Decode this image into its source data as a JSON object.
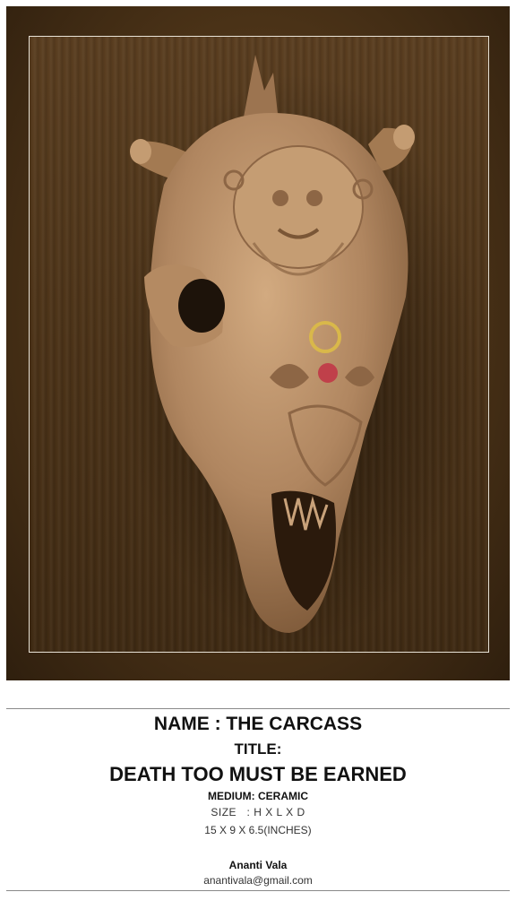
{
  "artwork": {
    "image_alt_subject": "ceramic skull sculpture",
    "name_line": "NAME : THE CARCASS",
    "title_label": "TITLE:",
    "title_value": "DEATH TOO MUST BE EARNED",
    "medium_line": "MEDIUM: CERAMIC",
    "size_line": "SIZE   : H X L X D",
    "dimensions_line": "15 X 9 X 6.5(INCHES)"
  },
  "artist": {
    "name": "Ananti Vala",
    "email": "anantivala@gmail.com"
  },
  "colors": {
    "frame": "#4a3217",
    "wood": "#4c3318",
    "clay": "#b88e64",
    "accent_red": "#c0404a",
    "accent_gold": "#d9b84a"
  }
}
